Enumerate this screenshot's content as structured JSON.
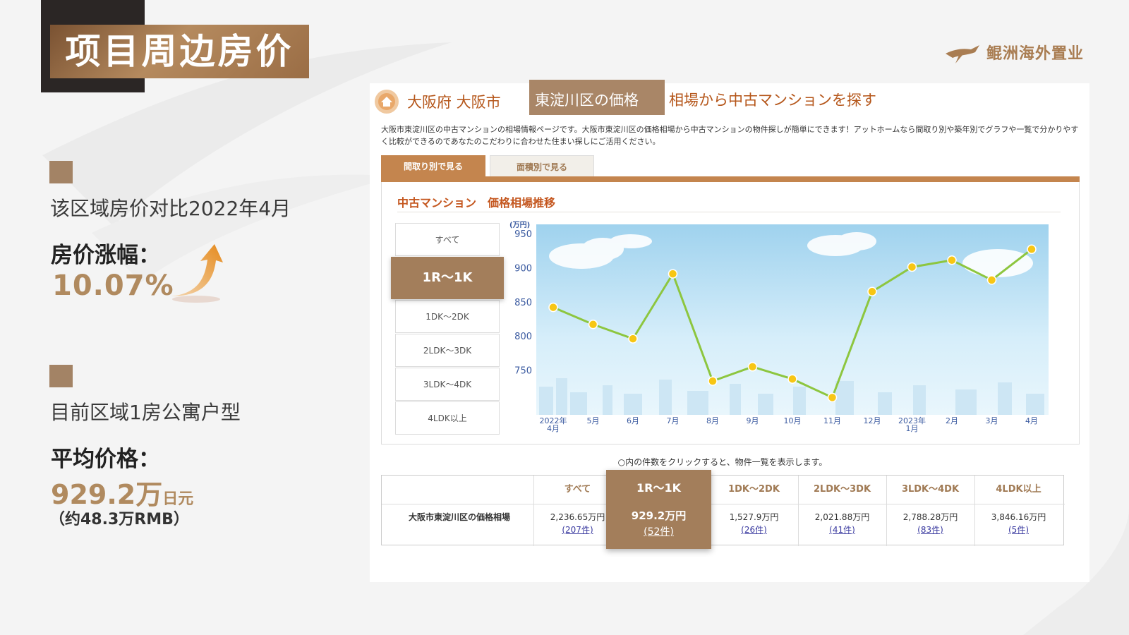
{
  "slide": {
    "title": "项目周边房价",
    "logo_text": "鲲洲海外置业"
  },
  "left": {
    "item1_label": "该区域房价对比2022年4月",
    "item1_heading": "房价涨幅：",
    "item1_value": "10.07%",
    "item2_label": "目前区域1房公寓户型",
    "item2_heading": "平均价格：",
    "item2_value_num": "929.2万",
    "item2_value_unit": "日元",
    "item2_note": "（约48.3万RMB）"
  },
  "screenshot": {
    "title_prefix": "大阪府 大阪市",
    "title_highlight": "東淀川区の価格",
    "title_suffix": "相場から中古マンションを探す",
    "description": "大阪市東淀川区の中古マンションの相場情報ページです。大阪市東淀川区の価格相場から中古マンションの物件探しが簡単にできます！アットホームなら間取り別や築年別でグラフや一覧で分かりやすく比較ができるのであなたのこだわりに合わせた住まい探しにご活用ください。",
    "tab_active": "間取り別で見る",
    "tab_inactive": "面積別で見る",
    "panel_title": "中古マンション　価格相場推移",
    "types": [
      "すべて",
      "1R〜1K",
      "1DK〜2DK",
      "2LDK〜3DK",
      "3LDK〜4DK",
      "4LDK以上"
    ],
    "note": "○内の件数をクリックすると、物件一覧を表示します。",
    "table": {
      "row_label": "大阪市東淀川区の価格相場",
      "columns": [
        {
          "header": "すべて",
          "value": "2,236.65万円",
          "count": "(207件)"
        },
        {
          "header": "1R〜1K",
          "value": "929.2万円",
          "count": "(52件)"
        },
        {
          "header": "1DK〜2DK",
          "value": "1,527.9万円",
          "count": "(26件)"
        },
        {
          "header": "2LDK〜3DK",
          "value": "2,021.88万円",
          "count": "(41件)"
        },
        {
          "header": "3LDK〜4DK",
          "value": "2,788.28万円",
          "count": "(83件)"
        },
        {
          "header": "4LDK以上",
          "value": "3,846.16万円",
          "count": "(5件)"
        }
      ]
    }
  },
  "chart_data": {
    "type": "line",
    "ylabel": "(万円)",
    "ylim": [
      700,
      950
    ],
    "yticks": [
      950,
      900,
      850,
      800,
      750
    ],
    "categories": [
      "2022年\n4月",
      "5月",
      "6月",
      "7月",
      "8月",
      "9月",
      "10月",
      "11月",
      "12月",
      "2023年\n1月",
      "2月",
      "3月",
      "4月"
    ],
    "values": [
      843,
      818,
      797,
      892,
      735,
      756,
      738,
      711,
      866,
      902,
      912,
      883,
      928
    ],
    "line_color": "#8dc63f",
    "marker_color": "#f7c614"
  },
  "colors": {
    "accent": "#b08a5f",
    "brand_brown": "#a37e5b",
    "site_orange": "#c4854e"
  }
}
